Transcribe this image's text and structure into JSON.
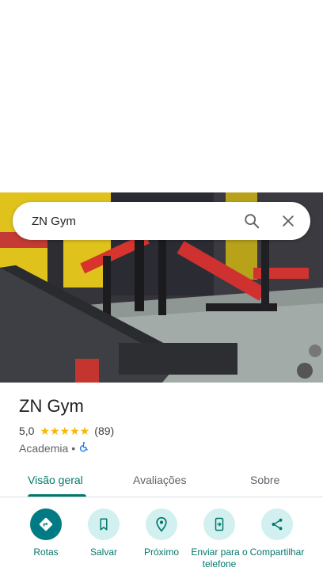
{
  "search": {
    "query": "ZN Gym"
  },
  "place": {
    "name": "ZN Gym",
    "rating": "5,0",
    "stars": 5,
    "review_count": "(89)",
    "category": "Academia",
    "separator": "•",
    "accessibility_icon": "wheelchair-icon"
  },
  "tabs": [
    {
      "label": "Visão geral",
      "active": true
    },
    {
      "label": "Avaliações",
      "active": false
    },
    {
      "label": "Sobre",
      "active": false
    }
  ],
  "actions": [
    {
      "label": "Rotas",
      "icon": "directions-icon"
    },
    {
      "label": "Salvar",
      "icon": "bookmark-icon"
    },
    {
      "label": "Próximo",
      "icon": "nearby-icon"
    },
    {
      "label": "Enviar para o telefone",
      "icon": "send-to-phone-icon"
    },
    {
      "label": "Compartilhar",
      "icon": "share-icon"
    }
  ],
  "colors": {
    "accent": "#00796b",
    "action_bg": "#d2f0ef",
    "primary_action_bg": "#007b83",
    "star": "#f6b704"
  }
}
